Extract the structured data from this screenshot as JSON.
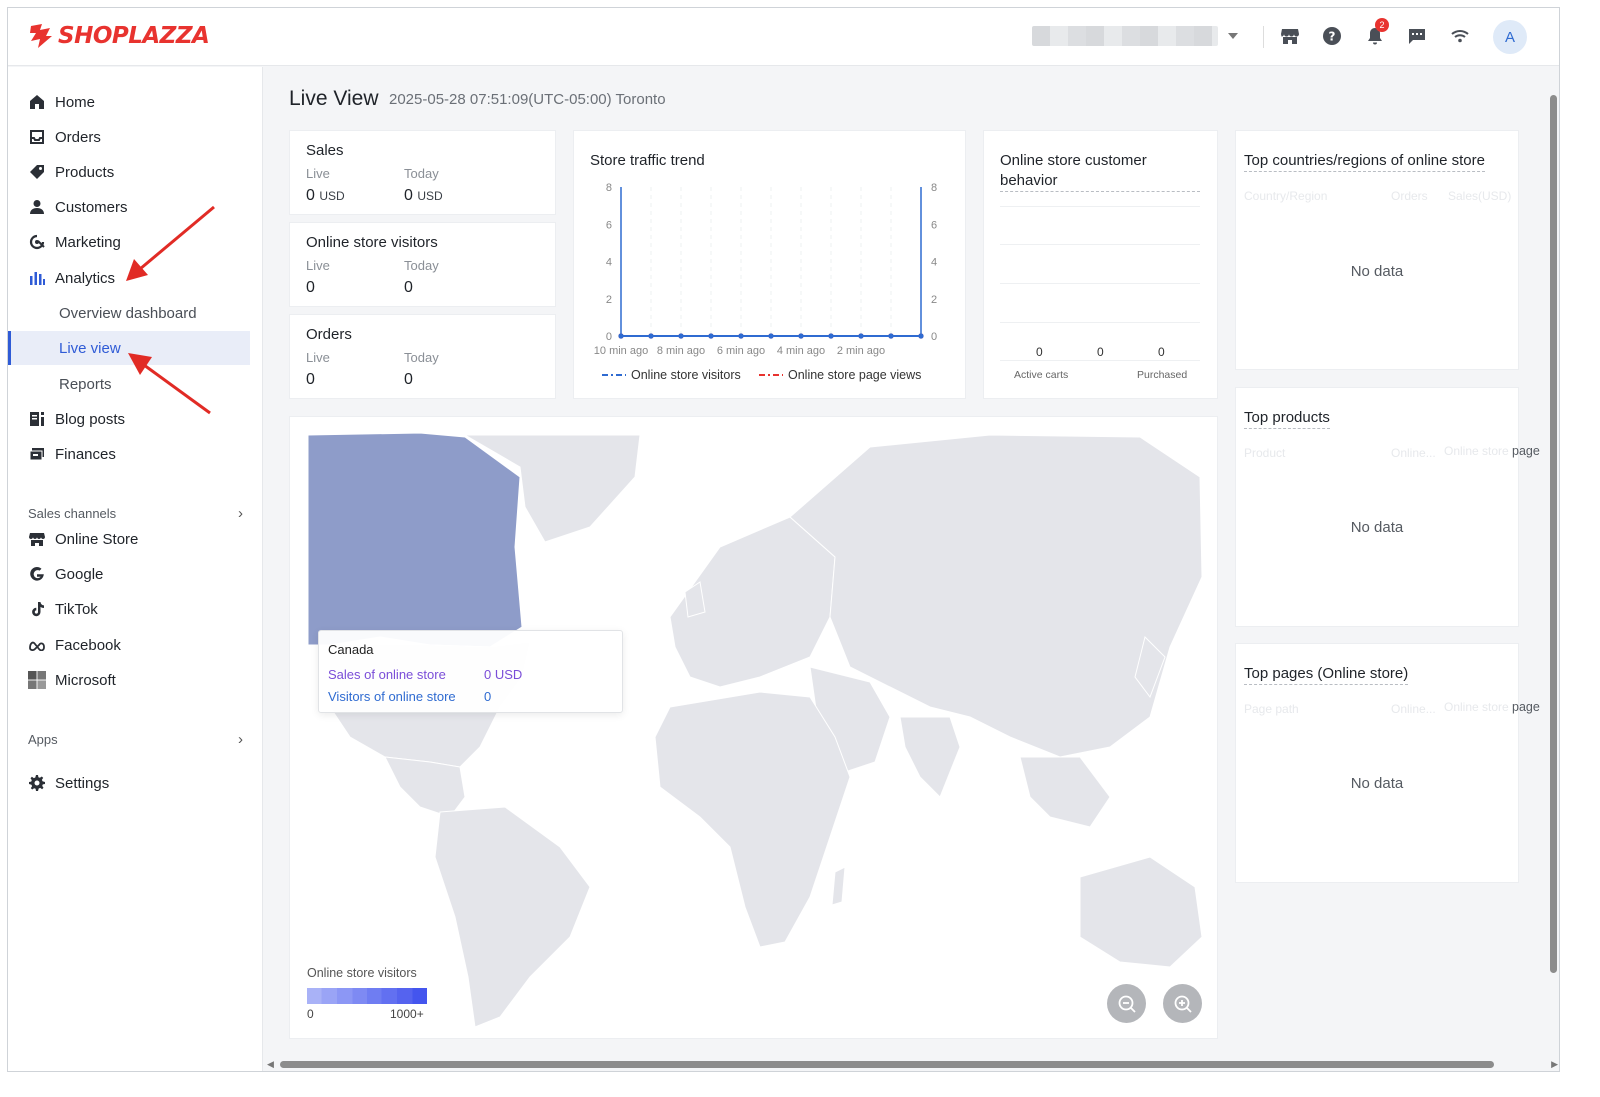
{
  "brand": {
    "name": "SHOPLAZZA",
    "color": "#e8332f",
    "accent": "#2f5bd6"
  },
  "topbar": {
    "notification_count": "2",
    "avatar_initial": "A"
  },
  "sidebar": {
    "items": [
      {
        "label": "Home",
        "icon": "home-icon"
      },
      {
        "label": "Orders",
        "icon": "orders-icon"
      },
      {
        "label": "Products",
        "icon": "tag-icon"
      },
      {
        "label": "Customers",
        "icon": "person-icon"
      },
      {
        "label": "Marketing",
        "icon": "marketing-icon"
      },
      {
        "label": "Analytics",
        "icon": "bar-chart-icon"
      }
    ],
    "analytics_sub": [
      {
        "label": "Overview dashboard"
      },
      {
        "label": "Live view",
        "active": true
      },
      {
        "label": "Reports"
      }
    ],
    "items2": [
      {
        "label": "Blog posts",
        "icon": "blog-icon"
      },
      {
        "label": "Finances",
        "icon": "finance-icon"
      }
    ],
    "sales_channels_label": "Sales channels",
    "channels": [
      {
        "label": "Online Store",
        "icon": "store-icon"
      },
      {
        "label": "Google",
        "icon": "google-icon"
      },
      {
        "label": "TikTok",
        "icon": "tiktok-icon"
      },
      {
        "label": "Facebook",
        "icon": "meta-icon"
      },
      {
        "label": "Microsoft",
        "icon": "microsoft-icon"
      }
    ],
    "apps_label": "Apps",
    "settings_label": "Settings"
  },
  "page": {
    "title": "Live View",
    "subtitle": "2025-05-28 07:51:09(UTC-05:00) Toronto"
  },
  "sales": {
    "title": "Sales",
    "live_label": "Live",
    "today_label": "Today",
    "live_value": "0",
    "today_value": "0",
    "currency": "USD"
  },
  "visitors": {
    "title": "Online store visitors",
    "live_label": "Live",
    "today_label": "Today",
    "live_value": "0",
    "today_value": "0"
  },
  "orders": {
    "title": "Orders",
    "live_label": "Live",
    "today_label": "Today",
    "live_value": "0",
    "today_value": "0"
  },
  "traffic": {
    "title": "Store traffic trend",
    "legend_visitors": "Online store visitors",
    "legend_pageviews": "Online store page views",
    "colors": {
      "visitors": "#2f6bd1",
      "pageviews": "#e8332f"
    }
  },
  "chart_data": [
    {
      "type": "line",
      "title": "Store traffic trend",
      "x_ticks": [
        "10 min ago",
        "8 min ago",
        "6 min ago",
        "4 min ago",
        "2 min ago"
      ],
      "ylim": [
        0,
        8
      ],
      "y_ticks": [
        0,
        2,
        4,
        6,
        8
      ],
      "series": [
        {
          "name": "Online store visitors",
          "values": [
            0,
            0,
            0,
            0,
            0,
            0,
            0,
            0,
            0,
            0,
            0
          ]
        },
        {
          "name": "Online store page views",
          "values": [
            0,
            0,
            0,
            0,
            0,
            0,
            0,
            0,
            0,
            0,
            0
          ]
        }
      ]
    },
    {
      "type": "bar",
      "title": "Online store customer behavior",
      "categories": [
        "Active carts",
        "",
        "Purchased"
      ],
      "values": [
        0,
        0,
        0
      ]
    }
  ],
  "behavior": {
    "title": "Online store customer behavior",
    "values": [
      "0",
      "0",
      "0"
    ],
    "labels": [
      "Active carts",
      "Purchased"
    ]
  },
  "top_countries": {
    "title": "Top countries/regions of online store",
    "headers": [
      "Country/Region",
      "Orders",
      "Sales(USD)"
    ],
    "empty": "No data"
  },
  "top_products": {
    "title": "Top products",
    "headers": [
      "Product",
      "Online...",
      "Online store page"
    ],
    "empty": "No data"
  },
  "top_pages": {
    "title": "Top pages (Online store)",
    "headers": [
      "Page path",
      "Online...",
      "Online store page"
    ],
    "empty": "No data"
  },
  "map": {
    "tooltip_country": "Canada",
    "tooltip_sales_label": "Sales of online store",
    "tooltip_sales_value": "0 USD",
    "tooltip_visitors_label": "Visitors of online store",
    "tooltip_visitors_value": "0",
    "legend_title": "Online store visitors",
    "legend_min": "0",
    "legend_max": "1000+",
    "highlight_color": "#8e9cc9",
    "land_color": "#e4e5ea"
  }
}
